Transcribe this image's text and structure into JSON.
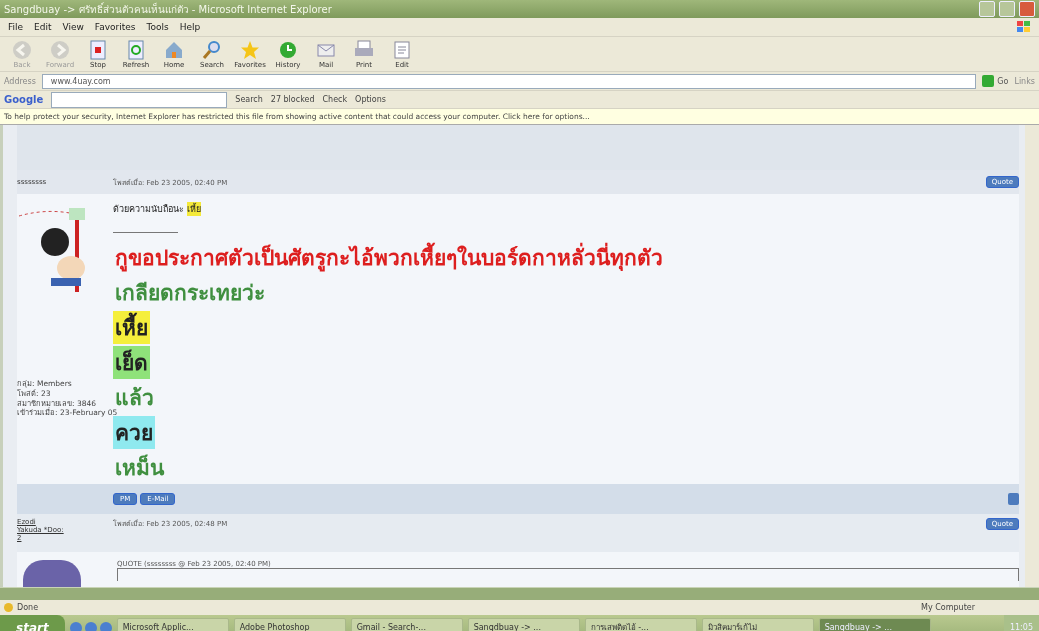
{
  "window": {
    "title": "Sangdbuay -> ศรัทธิ์ส่วนตัวคนเห็นแก่ตัว - Microsoft Internet Explorer"
  },
  "menu": [
    "File",
    "Edit",
    "View",
    "Favorites",
    "Tools",
    "Help"
  ],
  "toolbar": [
    {
      "label": "Back",
      "kind": "back",
      "disabled": true
    },
    {
      "label": "Forward",
      "kind": "forward",
      "disabled": true
    },
    {
      "label": "Stop",
      "kind": "stop",
      "disabled": false
    },
    {
      "label": "Refresh",
      "kind": "refresh",
      "disabled": false
    },
    {
      "label": "Home",
      "kind": "home",
      "disabled": false
    },
    {
      "label": "Search",
      "kind": "search",
      "disabled": false
    },
    {
      "label": "Favorites",
      "kind": "star",
      "disabled": false
    },
    {
      "label": "History",
      "kind": "history",
      "disabled": false
    },
    {
      "label": "Mail",
      "kind": "mail",
      "disabled": false
    },
    {
      "label": "Print",
      "kind": "print",
      "disabled": false
    },
    {
      "label": "Edit",
      "kind": "edit",
      "disabled": false
    }
  ],
  "address": {
    "label": "Address",
    "value": "www.4uay.com",
    "go": "Go",
    "links": "Links"
  },
  "google_bar": {
    "logo": "Google",
    "search": "Search",
    "blocked": "27 blocked",
    "check": "Check",
    "options": "Options"
  },
  "info_bar": "To help protect your security, Internet Explorer has restricted this file from showing active content that could access your computer. Click here for options...",
  "posts": [
    {
      "author": "ssssssss",
      "posted": "โพสต์เมื่อ: Feb 23 2005, 02:40 PM",
      "quote_button": "Quote",
      "member_info": [
        "กลุ่ม: Members",
        "โพสต์: 23",
        "สมาชิกหมายเลข: 3846",
        "เข้าร่วมเมื่อ: 23-February 05"
      ],
      "lines": [
        {
          "text": "ด้วยความนับถือนะ",
          "kind": "small"
        },
        {
          "text": "เหี้ย",
          "kind": "small-highlighted",
          "color": "#f5ea3a"
        },
        {
          "text": "กูขอประกาศตัวเป็นศัตรูกะไอ้พวกเหี้ยๆในบอร์ดกาหลั่วนี่ทุกตัว",
          "kind": "big",
          "color": "#dd1e1e"
        },
        {
          "text": "เกลียดกระเทยว่ะ",
          "kind": "big",
          "color": "#3f8f3f"
        },
        {
          "text": "เหี้ย",
          "kind": "big-highlighted",
          "color": "#f5ef3c"
        },
        {
          "text": "เย็ด",
          "kind": "big-highlighted",
          "color": "#8fe27a"
        },
        {
          "text": "แล้ว",
          "kind": "big",
          "color": "#3f8f3f"
        },
        {
          "text": "ควย",
          "kind": "big-highlighted",
          "color": "#8fe9ef"
        },
        {
          "text": "เหม็น",
          "kind": "big",
          "color": "#3f8f3f"
        }
      ],
      "actions": [
        "PM",
        "E-Mail"
      ]
    },
    {
      "author": "Ezodi",
      "author_line2": "Yakuda *Doo:",
      "author_line3": "2",
      "posted": "โพสต์เมื่อ: Feb 23 2005, 02:48 PM",
      "quote_button": "Quote",
      "quote_header": "QUOTE (ssssssss @ Feb 23 2005, 02:40 PM)"
    }
  ],
  "status_bar": {
    "text": "Done",
    "zone": "My Computer"
  },
  "taskbar": {
    "start": "start",
    "items": [
      {
        "label": "Microsoft Applic...",
        "selected": false
      },
      {
        "label": "Adobe Photoshop",
        "selected": false
      },
      {
        "label": "Gmail - Search-...",
        "selected": false
      },
      {
        "label": "Sangdbuay -> ...",
        "selected": false
      },
      {
        "label": "การเสพติดไอ้ -...",
        "selected": false
      },
      {
        "label": "มิวสิคมาร์เก้ไม่",
        "selected": false
      },
      {
        "label": "Sangdbuay -> ...",
        "selected": true
      }
    ],
    "clock": "11:05"
  }
}
